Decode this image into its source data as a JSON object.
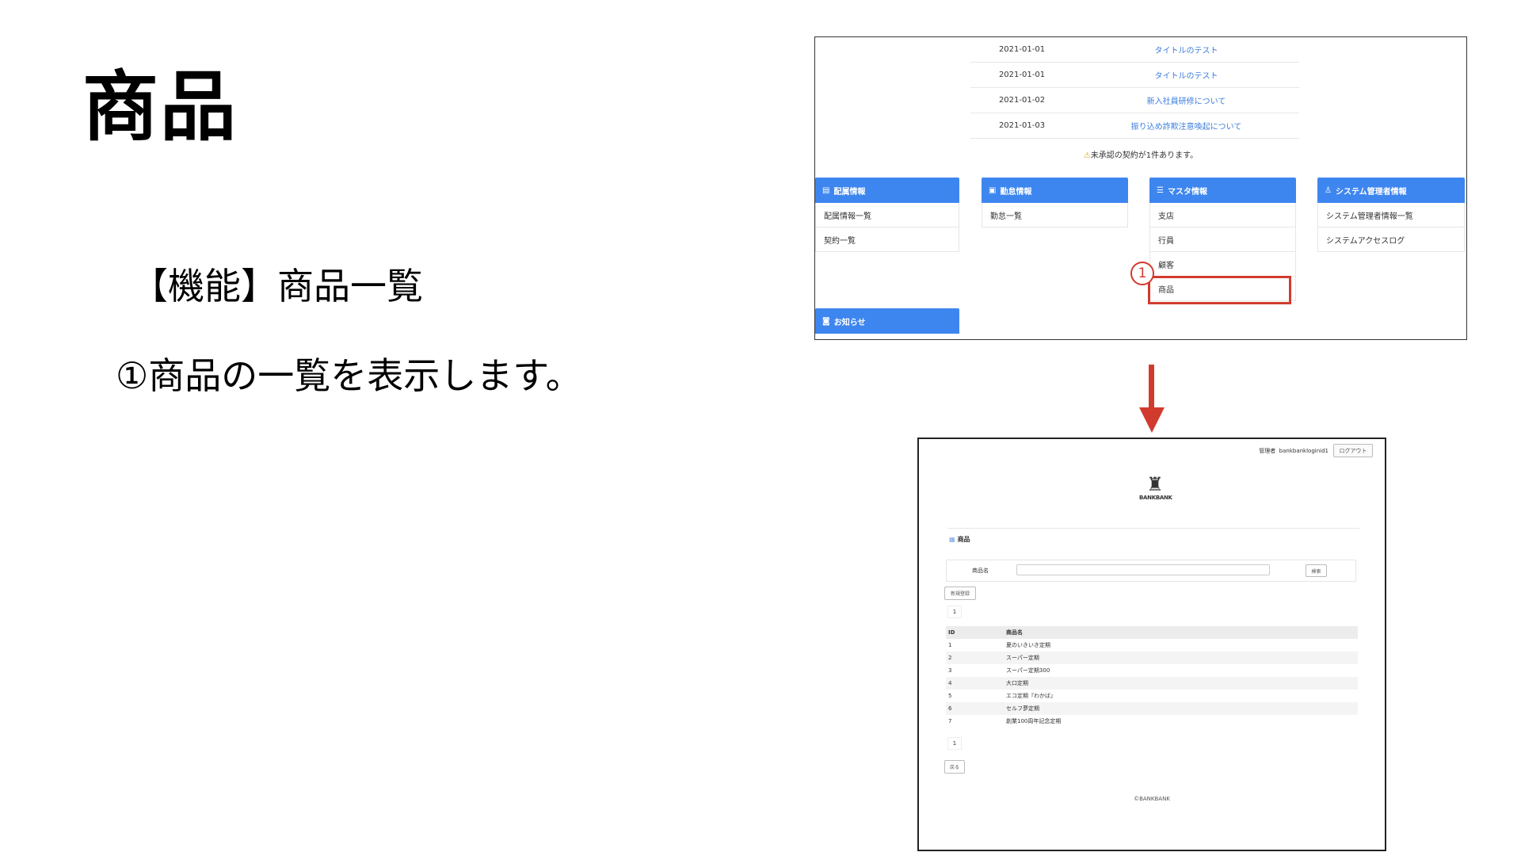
{
  "slide": {
    "title": "商品",
    "feature": "【機能】商品一覧",
    "description": "①商品の一覧を表示します。"
  },
  "portal": {
    "news": [
      {
        "date": "2021-01-01",
        "title": "タイトルのテスト"
      },
      {
        "date": "2021-01-01",
        "title": "タイトルのテスト"
      },
      {
        "date": "2021-01-02",
        "title": "新入社員研修について"
      },
      {
        "date": "2021-01-03",
        "title": "振り込め詐欺注意喚起について"
      }
    ],
    "warning": "未承認の契約が1件あります。",
    "cards": [
      {
        "header": "配属情報",
        "icon": "building-icon",
        "items": [
          "配属情報一覧",
          "契約一覧"
        ]
      },
      {
        "header": "勤怠情報",
        "icon": "id-card-icon",
        "items": [
          "勤怠一覧"
        ]
      },
      {
        "header": "マスタ情報",
        "icon": "database-icon",
        "items": [
          "支店",
          "行員",
          "顧客",
          "商品"
        ]
      },
      {
        "header": "システム管理者情報",
        "icon": "user-icon",
        "items": [
          "システム管理者情報一覧",
          "システムアクセスログ"
        ]
      }
    ],
    "news_card_header": "お知らせ",
    "marker": "1"
  },
  "product_page": {
    "role": "管理者",
    "user_id": "bankbankloginid1",
    "logout": "ログアウト",
    "logo_text": "BANKBANK",
    "title": "商品",
    "search_label": "商品名",
    "search_value": "",
    "search_button": "検索",
    "new_button": "新規登録",
    "page_number": "1",
    "columns": [
      "ID",
      "商品名"
    ],
    "rows": [
      [
        "1",
        "夏のいきいき定期"
      ],
      [
        "2",
        "スーパー定期"
      ],
      [
        "3",
        "スーパー定期300"
      ],
      [
        "4",
        "大口定期"
      ],
      [
        "5",
        "エコ定期『わかば』"
      ],
      [
        "6",
        "セルフ夢定期"
      ],
      [
        "7",
        "創業100周年記念定期"
      ]
    ],
    "back_button": "戻る",
    "copyright": "©BANKBANK"
  },
  "colors": {
    "accent": "#3e86ef",
    "highlight": "#d13b2e",
    "link": "#3b7ddd"
  }
}
